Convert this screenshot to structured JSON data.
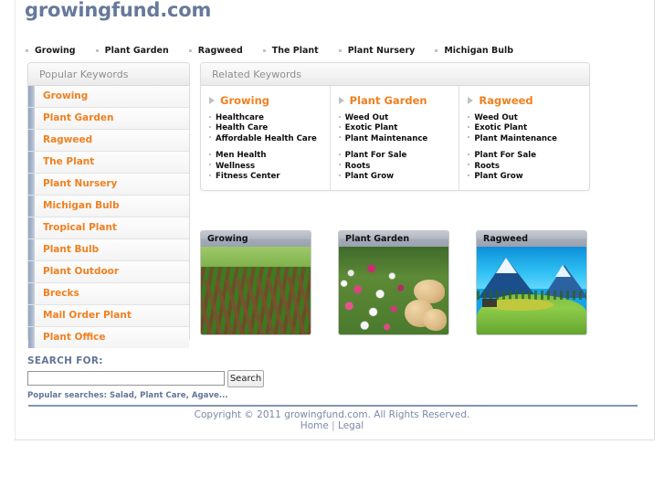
{
  "site": {
    "logo": "growingfund.com"
  },
  "topnav": {
    "items": [
      {
        "label": "Growing"
      },
      {
        "label": "Plant Garden"
      },
      {
        "label": "Ragweed"
      },
      {
        "label": "The Plant"
      },
      {
        "label": "Plant Nursery"
      },
      {
        "label": "Michigan Bulb"
      }
    ]
  },
  "sidebar": {
    "title": "Popular Keywords",
    "accent_color": "#f08020",
    "bar_color": "#a0aec4",
    "items": [
      {
        "label": "Growing"
      },
      {
        "label": "Plant Garden"
      },
      {
        "label": "Ragweed"
      },
      {
        "label": "The Plant"
      },
      {
        "label": "Plant Nursery"
      },
      {
        "label": "Michigan Bulb"
      },
      {
        "label": "Tropical Plant"
      },
      {
        "label": "Plant Bulb"
      },
      {
        "label": "Plant Outdoor"
      },
      {
        "label": "Brecks"
      },
      {
        "label": "Mail Order Plant"
      },
      {
        "label": "Plant Office"
      }
    ]
  },
  "related": {
    "title": "Related Keywords",
    "columns": [
      {
        "heading": "Growing",
        "group1": [
          "Healthcare",
          "Health Care",
          "Affordable Health Care"
        ],
        "group2": [
          "Men Health",
          "Wellness",
          "Fitness Center"
        ]
      },
      {
        "heading": "Plant Garden",
        "group1": [
          "Weed Out",
          "Exotic Plant",
          "Plant Maintenance"
        ],
        "group2": [
          "Plant For Sale",
          "Roots",
          "Plant Grow"
        ]
      },
      {
        "heading": "Ragweed",
        "group1": [
          "Weed Out",
          "Exotic Plant",
          "Plant Maintenance"
        ],
        "group2": [
          "Plant For Sale",
          "Roots",
          "Plant Grow"
        ]
      }
    ]
  },
  "cards": [
    {
      "title": "Growing",
      "image": "lettuce-field-photo"
    },
    {
      "title": "Plant Garden",
      "image": "flower-garden-rocks-photo"
    },
    {
      "title": "Ragweed",
      "image": "alpine-mountain-meadow-photo"
    }
  ],
  "search": {
    "label": "SEARCH FOR:",
    "value": "",
    "placeholder": "",
    "button_label": "Search",
    "popular": "Popular searches: Salad, Plant Care, Agave..."
  },
  "footer": {
    "copyright": "Copyright © 2011 growingfund.com. All Rights Reserved.",
    "home_label": "Home",
    "separator": "|",
    "legal_label": "Legal",
    "rule_color": "#8693b4"
  }
}
